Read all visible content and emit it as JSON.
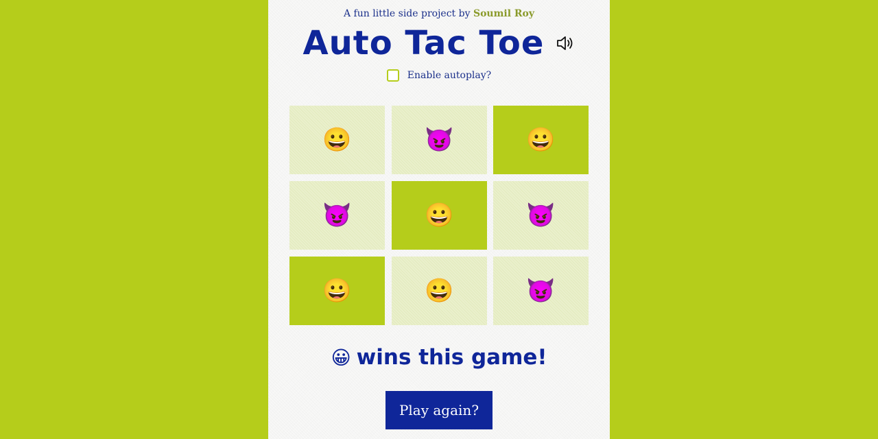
{
  "header": {
    "byline_prefix": "A fun little side project by",
    "author": "Soumil Roy",
    "title": "Auto Tac Toe",
    "sound_icon": "speaker-icon"
  },
  "autoplay": {
    "label": "Enable autoplay?",
    "checked": false
  },
  "players": {
    "smile": "😀",
    "devil": "😈"
  },
  "board": [
    {
      "symbol": "😀",
      "winning": false
    },
    {
      "symbol": "😈",
      "winning": false
    },
    {
      "symbol": "😀",
      "winning": true
    },
    {
      "symbol": "😈",
      "winning": false
    },
    {
      "symbol": "😀",
      "winning": true
    },
    {
      "symbol": "😈",
      "winning": false
    },
    {
      "symbol": "😀",
      "winning": true
    },
    {
      "symbol": "😀",
      "winning": false
    },
    {
      "symbol": "😈",
      "winning": false
    }
  ],
  "result": {
    "winner": "😀",
    "message": "wins this game!"
  },
  "actions": {
    "play_again": "Play again?"
  },
  "colors": {
    "background": "#b5cd1b",
    "primary": "#0f2699",
    "cell": "#eaf0cc",
    "winning_cell": "#b5cd1b"
  }
}
